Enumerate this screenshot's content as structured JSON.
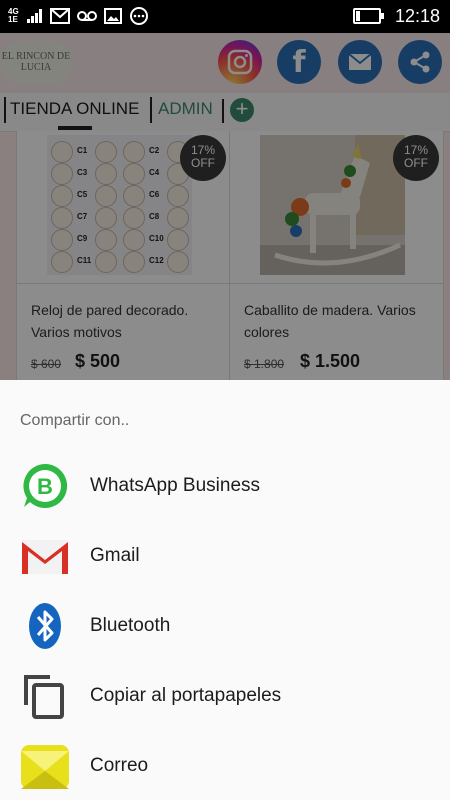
{
  "status_bar": {
    "network": "4G",
    "network_sub": "1E",
    "time": "12:18",
    "battery_level": 0.2
  },
  "app": {
    "logo_text": "EL RINCON DE LUCIA",
    "social_icons": [
      "instagram-icon",
      "facebook-icon",
      "mail-icon",
      "share-icon"
    ],
    "facebook_letter": "f",
    "tabs": [
      {
        "label": "TIENDA ONLINE",
        "active": true
      },
      {
        "label": "ADMIN",
        "active": false
      }
    ],
    "add_icon": "+",
    "products": [
      {
        "title": "Reloj de pared decorado. Varios motivos",
        "old_price": "$ 600",
        "price": "$ 500",
        "badge_pct": "17%",
        "badge_off": "OFF",
        "clock_labels": [
          "C1",
          "C2",
          "C3",
          "C4",
          "C5",
          "C6",
          "C7",
          "C8",
          "C9",
          "C10",
          "C11",
          "C12"
        ]
      },
      {
        "title": "Caballito de madera. Varios colores",
        "old_price": "$ 1.800",
        "price": "$ 1.500",
        "badge_pct": "17%",
        "badge_off": "OFF"
      }
    ]
  },
  "share_sheet": {
    "title": "Compartir con..",
    "items": [
      {
        "label": "WhatsApp Business",
        "icon": "whatsapp-business-icon",
        "icon_letter": "B",
        "color": "#2fb844"
      },
      {
        "label": "Gmail",
        "icon": "gmail-icon",
        "color": "#d93025"
      },
      {
        "label": "Bluetooth",
        "icon": "bluetooth-icon",
        "color": "#1565c0"
      },
      {
        "label": "Copiar al portapapeles",
        "icon": "copy-icon",
        "color": "#444444"
      },
      {
        "label": "Correo",
        "icon": "correo-icon",
        "color": "#e8e01a"
      }
    ]
  }
}
